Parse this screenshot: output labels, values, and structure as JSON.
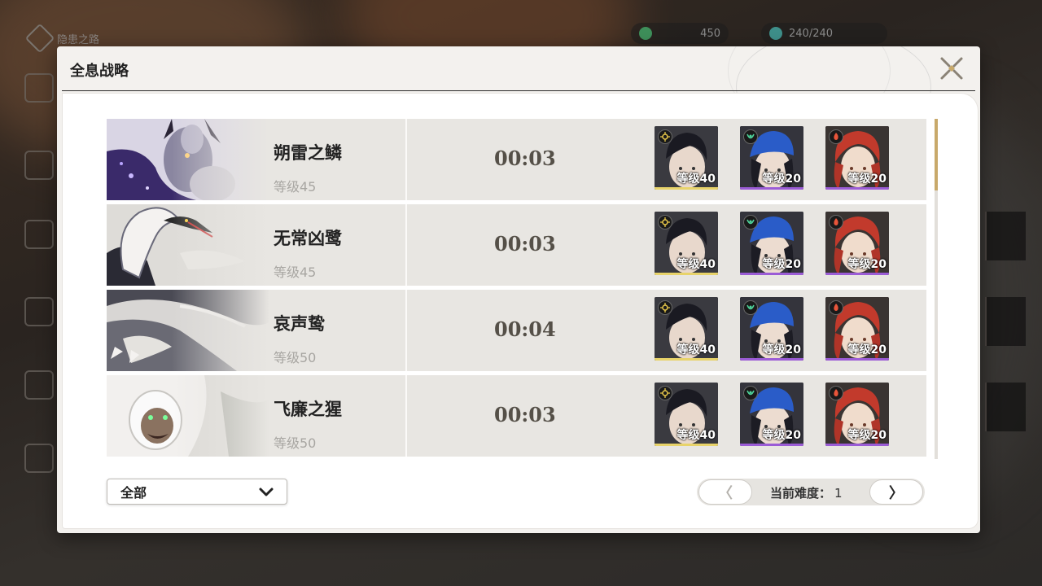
{
  "panel": {
    "title": "全息战略"
  },
  "hud": {
    "location": "隐患之路",
    "currency_a": "450",
    "currency_b": "240/240"
  },
  "bosses": [
    {
      "name": "朔雷之鳞",
      "level": "等级45",
      "time": "00:03",
      "portrait": "purple-dragon"
    },
    {
      "name": "无常凶鹭",
      "level": "等级45",
      "time": "00:03",
      "portrait": "white-heron"
    },
    {
      "name": "哀声鸷",
      "level": "等级50",
      "time": "00:04",
      "portrait": "grey-bird"
    },
    {
      "name": "飞廉之猩",
      "level": "等级50",
      "time": "00:03",
      "portrait": "white-ape"
    }
  ],
  "team": [
    {
      "level": "等级40",
      "element": "spectro-icon",
      "bar_color": "#e8d36a",
      "element_color": "#e8c84a"
    },
    {
      "level": "等级20",
      "element": "aero-icon",
      "bar_color": "#9b5cd6",
      "element_color": "#4ed39a"
    },
    {
      "level": "等级20",
      "element": "fusion-icon",
      "bar_color": "#9b5cd6",
      "element_color": "#e8553a"
    }
  ],
  "filter": {
    "label": "全部"
  },
  "pager": {
    "prev_label": "〈",
    "next_label": "〉",
    "difficulty_label": "当前难度：",
    "difficulty_value": "1"
  },
  "colors": {
    "accent": "#c8a96a",
    "panel_bg": "#f3f1ee",
    "row_bg": "#e8e6e2"
  }
}
